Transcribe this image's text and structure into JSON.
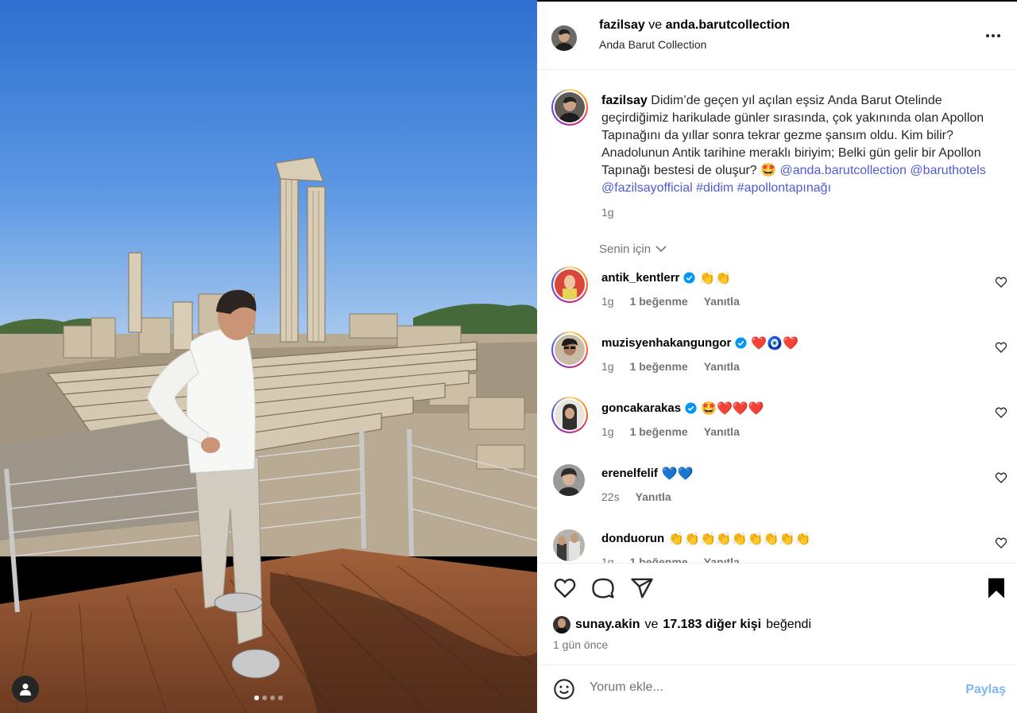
{
  "post": {
    "owner": "fazilsay",
    "connector": " ve ",
    "collaborator": "anda.barutcollection",
    "location": "Anda Barut Collection",
    "image_dots": 4,
    "active_dot": 0
  },
  "caption": {
    "user": "fazilsay",
    "text": "Didim’de geçen yıl açılan eşsiz Anda Barut Otelinde geçirdiğimiz harikulade günler sırasında, çok yakınında olan Apollon Tapınağını da yıllar sonra tekrar gezme şansım oldu. Kim bilir? Anadolunun Antik tarihine meraklı biriyim; Belki gün gelir bir Apollon Tapınağı bestesi de oluşur? 🤩",
    "mention": "@anda.barutcollection",
    "tags": "@baruthotels @fazilsayofficial #didim #apollontapınağı",
    "time": "1g"
  },
  "sort_label": "Senin için",
  "comments": [
    {
      "user": "antik_kentlerr",
      "verified": true,
      "text": "👏👏",
      "time": "1g",
      "likes": "1 beğenme",
      "reply": "Yanıtla"
    },
    {
      "user": "muzisyenhakangungor",
      "verified": true,
      "text": "❤️🧿❤️",
      "time": "1g",
      "likes": "1 beğenme",
      "reply": "Yanıtla"
    },
    {
      "user": "goncakarakas",
      "verified": true,
      "text": "🤩❤️❤️❤️",
      "time": "1g",
      "likes": "1 beğenme",
      "reply": "Yanıtla"
    },
    {
      "user": "erenelfelif",
      "verified": false,
      "text": "💙💙",
      "time": "22s",
      "likes": "",
      "reply": "Yanıtla"
    },
    {
      "user": "donduorun",
      "verified": false,
      "text": "👏👏👏👏👏👏👏👏👏",
      "time": "1g",
      "likes": "1 beğenme",
      "reply": "Yanıtla"
    }
  ],
  "likes": {
    "user": "sunay.akin",
    "connector": "ve",
    "others": "17.183 diğer kişi",
    "suffix": "beğendi"
  },
  "time_ago": "1 gün önce",
  "comment_box": {
    "placeholder": "Yorum ekle...",
    "share": "Paylaş"
  },
  "colors": {
    "link": "#4f5bd5",
    "verified": "#0095f6",
    "share_disabled": "#7fb7f5"
  }
}
